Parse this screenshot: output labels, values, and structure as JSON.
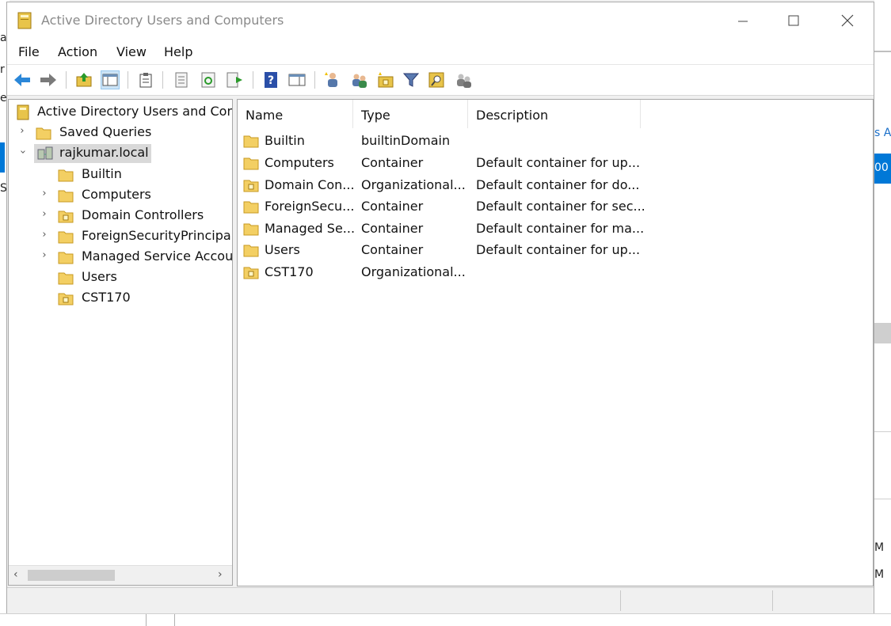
{
  "window": {
    "title": "Active Directory Users and Computers"
  },
  "menu": [
    "File",
    "Action",
    "View",
    "Help"
  ],
  "toolbar": [
    {
      "name": "back-arrow-icon"
    },
    {
      "name": "forward-arrow-icon"
    },
    {
      "name": "up-folder-icon"
    },
    {
      "name": "show-hide-console-tree-icon"
    },
    {
      "name": "clipboard-icon"
    },
    {
      "name": "properties-icon"
    },
    {
      "name": "refresh-icon"
    },
    {
      "name": "export-list-icon"
    },
    {
      "name": "help-icon"
    },
    {
      "name": "show-action-pane-icon"
    },
    {
      "name": "new-user-icon"
    },
    {
      "name": "new-group-icon"
    },
    {
      "name": "new-ou-icon"
    },
    {
      "name": "filter-icon"
    },
    {
      "name": "find-icon"
    },
    {
      "name": "add-to-group-icon"
    }
  ],
  "tree": {
    "root": "Active Directory Users and Com",
    "saved_queries": "Saved Queries",
    "domain": "rajkumar.local",
    "children": [
      {
        "label": "Builtin",
        "expandable": false,
        "ou": false
      },
      {
        "label": "Computers",
        "expandable": true,
        "ou": false
      },
      {
        "label": "Domain Controllers",
        "expandable": true,
        "ou": true
      },
      {
        "label": "ForeignSecurityPrincipals",
        "expandable": true,
        "ou": false
      },
      {
        "label": "Managed Service Accour",
        "expandable": true,
        "ou": false
      },
      {
        "label": "Users",
        "expandable": false,
        "ou": false
      },
      {
        "label": "CST170",
        "expandable": false,
        "ou": true
      }
    ]
  },
  "list": {
    "columns": [
      "Name",
      "Type",
      "Description"
    ],
    "rows": [
      {
        "name": "Builtin",
        "type": "builtinDomain",
        "description": "",
        "ou": false
      },
      {
        "name": "Computers",
        "type": "Container",
        "description": "Default container for up...",
        "ou": false
      },
      {
        "name": "Domain Con...",
        "type": "Organizational...",
        "description": "Default container for do...",
        "ou": true
      },
      {
        "name": "ForeignSecu...",
        "type": "Container",
        "description": "Default container for sec...",
        "ou": false
      },
      {
        "name": "Managed Se...",
        "type": "Container",
        "description": "Default container for ma...",
        "ou": false
      },
      {
        "name": "Users",
        "type": "Container",
        "description": "Default container for up...",
        "ou": false
      },
      {
        "name": "CST170",
        "type": "Organizational...",
        "description": "",
        "ou": true
      }
    ]
  },
  "background": {
    "left_fragments": [
      "a",
      "r",
      "e",
      "S"
    ],
    "right_fragments": [
      "s Ac",
      "00",
      "M",
      "M"
    ]
  },
  "colors": {
    "selection": "#0078d7",
    "folder": "#f0c040"
  }
}
